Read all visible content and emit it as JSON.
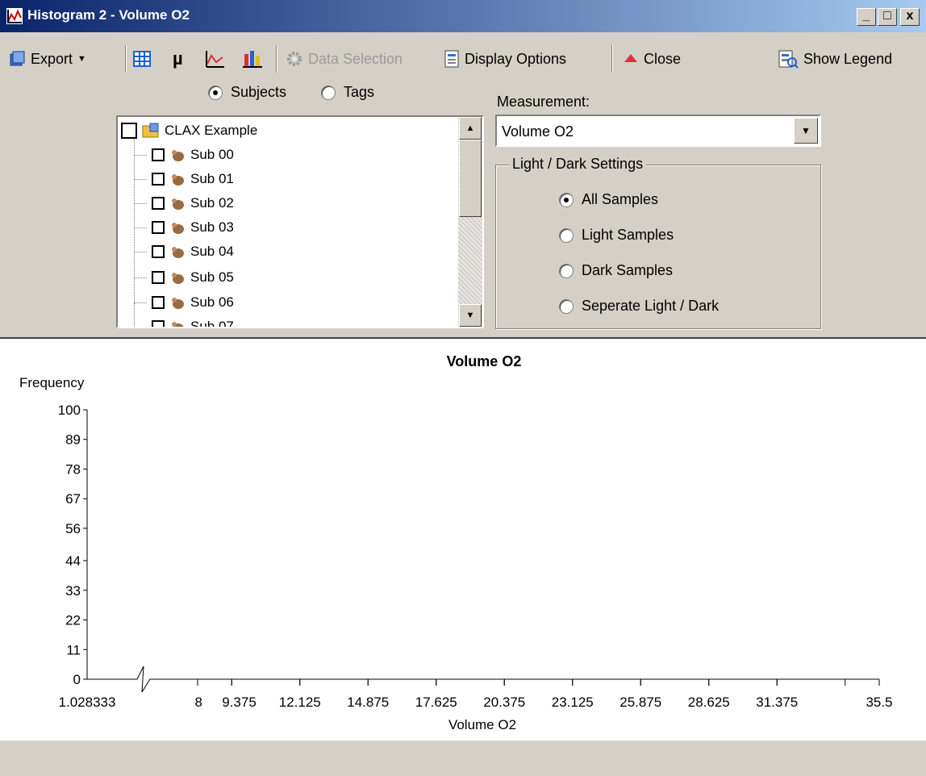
{
  "window": {
    "title": "Histogram 2 - Volume O2",
    "minimize": "_",
    "maximize": "□",
    "close": "x"
  },
  "toolbar": {
    "export_label": "Export",
    "data_selection_label": "Data Selection",
    "display_options_label": "Display Options",
    "close_label": "Close",
    "show_legend_label": "Show Legend",
    "mu_label": "µ"
  },
  "source": {
    "subjects_label": "Subjects",
    "tags_label": "Tags",
    "selected": "Subjects"
  },
  "tree": {
    "root": "CLAX Example",
    "items": [
      "Sub 00",
      "Sub 01",
      "Sub 02",
      "Sub 03",
      "Sub 04",
      "Sub 05",
      "Sub 06",
      "Sub 07"
    ]
  },
  "measurement": {
    "label": "Measurement:",
    "value": "Volume O2"
  },
  "light_dark": {
    "title": "Light / Dark Settings",
    "options": [
      "All Samples",
      "Light Samples",
      "Dark Samples",
      "Seperate Light / Dark"
    ],
    "selected": "All Samples"
  },
  "chart_data": {
    "type": "bar",
    "title": "Volume O2",
    "xlabel": "Volume O2",
    "ylabel": "Frequency",
    "ylim": [
      0,
      100
    ],
    "y_ticks": [
      "100",
      "89",
      "78",
      "67",
      "56",
      "44",
      "33",
      "22",
      "11",
      "0"
    ],
    "x_ticks": [
      "1.028333",
      "8",
      "9.375",
      "12.125",
      "14.875",
      "17.625",
      "20.375",
      "23.125",
      "25.875",
      "28.625",
      "31.375",
      "35.5"
    ],
    "axis_break": true,
    "series": [],
    "grid": false
  }
}
